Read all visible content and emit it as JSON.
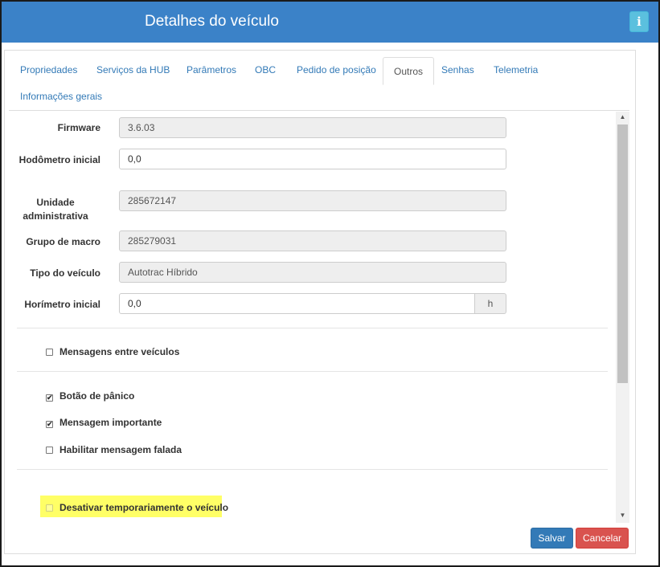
{
  "window": {
    "title": "Detalhes do veículo",
    "info_icon": "i"
  },
  "tabs": [
    {
      "label": "Propriedades"
    },
    {
      "label": "Serviços da HUB"
    },
    {
      "label": "Parâmetros"
    },
    {
      "label": "OBC"
    },
    {
      "label": "Pedido de posição"
    },
    {
      "label": "Outros",
      "active": true
    },
    {
      "label": "Senhas"
    },
    {
      "label": "Telemetria"
    },
    {
      "label": "Informações gerais"
    }
  ],
  "form": {
    "firmware": {
      "label": "Firmware",
      "value": "3.6.03"
    },
    "hodometro": {
      "label": "Hodômetro inicial",
      "value": "0,0"
    },
    "unidade": {
      "label_line1": "Unidade",
      "label_line2": "administrativa",
      "value": "285672147"
    },
    "grupo_macro": {
      "label": "Grupo de macro",
      "value": "285279031"
    },
    "tipo_veiculo": {
      "label": "Tipo do veículo",
      "value": "Autotrac Híbrido"
    },
    "horimetro": {
      "label": "Horímetro inicial",
      "value": "0,0",
      "unit": "h"
    }
  },
  "checks": {
    "mensagens_veiculos": {
      "label": "Mensagens entre veículos",
      "checked": false
    },
    "botao_panico": {
      "label": "Botão de pânico",
      "checked": true
    },
    "mensagem_importante": {
      "label": "Mensagem importante",
      "checked": true
    },
    "mensagem_falada": {
      "label": "Habilitar mensagem falada",
      "checked": false
    },
    "desativar": {
      "label": "Desativar temporariamente o veículo",
      "checked": false
    }
  },
  "marks": {
    "checked": "✔",
    "scroll_up": "▲",
    "scroll_down": "▼"
  },
  "footer": {
    "save_label": "Salvar",
    "cancel_label": "Cancelar"
  },
  "colors": {
    "header": "#3b82c8",
    "primary": "#337ab7",
    "danger": "#d9534f",
    "highlight": "#ffff66"
  }
}
